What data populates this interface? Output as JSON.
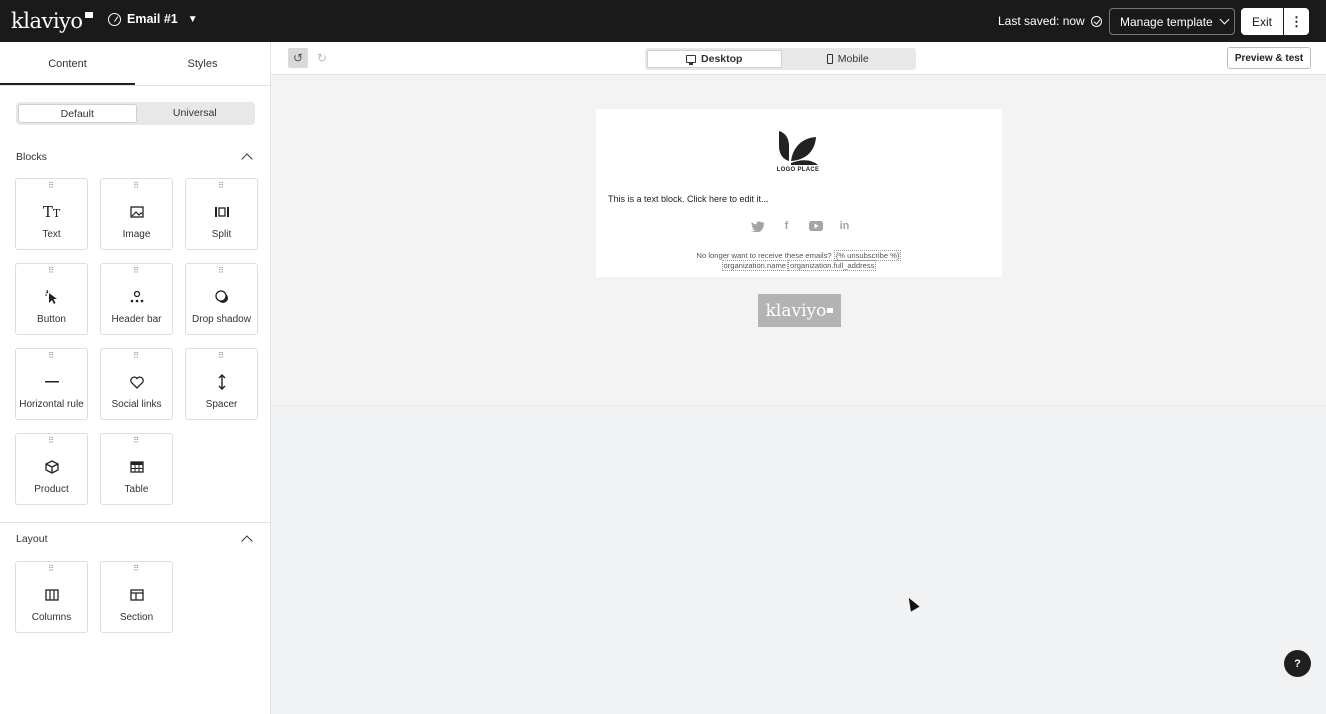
{
  "topbar": {
    "logo": "klaviyo",
    "email_title": "Email #1",
    "last_saved": "Last saved: now",
    "manage_template": "Manage template",
    "exit": "Exit",
    "more": "⋮"
  },
  "sidebar": {
    "tabs": [
      {
        "label": "Content"
      },
      {
        "label": "Styles"
      }
    ],
    "segments": [
      {
        "label": "Default"
      },
      {
        "label": "Universal"
      }
    ],
    "blocks_heading": "Blocks",
    "blocks": [
      {
        "label": "Text",
        "icon": "text-icon"
      },
      {
        "label": "Image",
        "icon": "image-icon"
      },
      {
        "label": "Split",
        "icon": "split-icon"
      },
      {
        "label": "Button",
        "icon": "button-icon"
      },
      {
        "label": "Header bar",
        "icon": "header-bar-icon"
      },
      {
        "label": "Drop shadow",
        "icon": "drop-shadow-icon"
      },
      {
        "label": "Horizontal rule",
        "icon": "horizontal-rule-icon"
      },
      {
        "label": "Social links",
        "icon": "heart-icon"
      },
      {
        "label": "Spacer",
        "icon": "spacer-icon"
      },
      {
        "label": "Product",
        "icon": "product-icon"
      },
      {
        "label": "Table",
        "icon": "table-icon"
      }
    ],
    "layout_heading": "Layout",
    "layout": [
      {
        "label": "Columns",
        "icon": "columns-icon"
      },
      {
        "label": "Section",
        "icon": "section-icon"
      }
    ]
  },
  "toolbar": {
    "desktop": "Desktop",
    "mobile": "Mobile",
    "preview": "Preview & test"
  },
  "email": {
    "logo_text": "LOGO PLACE",
    "text_block": "This is a text block. Click here to edit it...",
    "footer_prefix": "No longer want to receive these emails?",
    "unsubscribe_tag": "{% unsubscribe %}",
    "org_name_tag": "organization.name",
    "org_address_tag": "organization.full_address",
    "badge": "klaviyo"
  },
  "help": "?"
}
